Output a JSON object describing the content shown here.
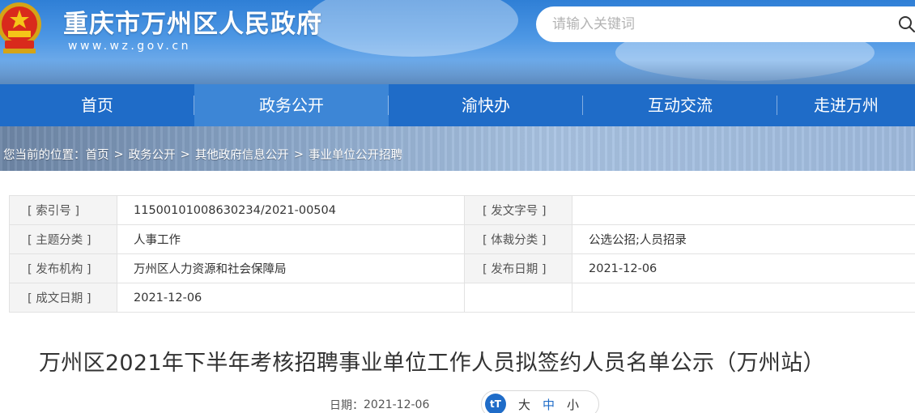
{
  "header": {
    "site_title": "重庆市万州区人民政府",
    "site_domain": "www.wz.gov.cn",
    "search_placeholder": "请输入关键词"
  },
  "nav": {
    "items": [
      {
        "label": "首页",
        "active": false
      },
      {
        "label": "政务公开",
        "active": true
      },
      {
        "label": "渝快办",
        "active": false
      },
      {
        "label": "互动交流",
        "active": false
      },
      {
        "label": "走进万州",
        "active": false
      }
    ]
  },
  "breadcrumb": {
    "prefix": "您当前的位置：",
    "items": [
      "首页",
      "政务公开",
      "其他政府信息公开",
      "事业单位公开招聘"
    ],
    "separator": ">"
  },
  "info": {
    "rows": [
      {
        "key1": "[ 索引号 ]",
        "val1": "11500101008630234/2021-00504",
        "key2": "[ 发文字号 ]",
        "val2": ""
      },
      {
        "key1": "[ 主题分类 ]",
        "val1": "人事工作",
        "key2": "[ 体裁分类 ]",
        "val2": "公选公招;人员招录"
      },
      {
        "key1": "[ 发布机构 ]",
        "val1": "万州区人力资源和社会保障局",
        "key2": "[ 发布日期 ]",
        "val2": "2021-12-06"
      },
      {
        "key1": "[ 成文日期 ]",
        "val1": "2021-12-06",
        "key2": "",
        "val2": ""
      }
    ]
  },
  "article": {
    "title": "万州区2021年下半年考核招聘事业单位工作人员拟签约人员名单公示（万州站）",
    "date_label": "日期：",
    "date": "2021-12-06",
    "font_sizes": [
      "大",
      "中",
      "小"
    ],
    "font_icon_text": "tT"
  },
  "colors": {
    "nav_bg": "#1f6cc8",
    "nav_active": "#3d86d6",
    "title_text": "#333333"
  }
}
